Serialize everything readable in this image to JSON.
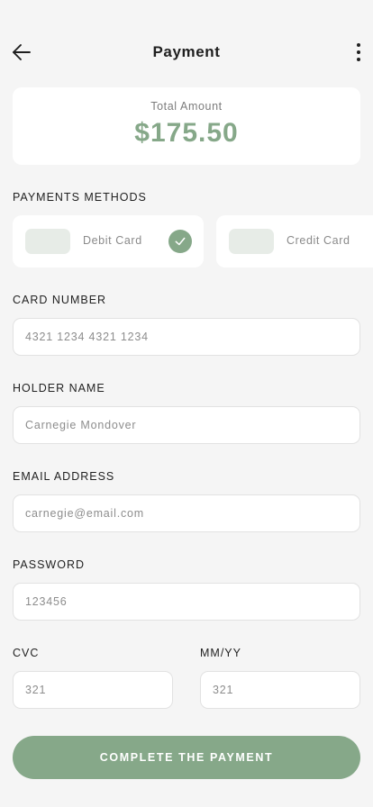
{
  "header": {
    "title": "Payment"
  },
  "total": {
    "label": "Total Amount",
    "amount": "$175.50"
  },
  "methods": {
    "section_label": "PAYMENTS METHODS",
    "items": [
      {
        "label": "Debit Card",
        "selected": true
      },
      {
        "label": "Credit Card",
        "selected": false
      }
    ]
  },
  "form": {
    "card_number": {
      "label": "CARD NUMBER",
      "placeholder": "4321 1234 4321 1234"
    },
    "holder_name": {
      "label": "HOLDER NAME",
      "placeholder": "Carnegie Mondover"
    },
    "email": {
      "label": "EMAIL ADDRESS",
      "placeholder": "carnegie@email.com"
    },
    "password": {
      "label": "PASSWORD",
      "placeholder": "123456"
    },
    "cvc": {
      "label": "CVC",
      "placeholder": "321"
    },
    "expiry": {
      "label": "MM/YY",
      "placeholder": "321"
    }
  },
  "actions": {
    "submit_label": "COMPLETE THE PAYMENT"
  },
  "colors": {
    "accent": "#86a889",
    "background": "#f5f5f5",
    "card": "#ffffff",
    "chip": "#e7ece7"
  },
  "icons": {
    "back": "arrow-left-icon",
    "more": "more-vertical-icon",
    "check": "check-icon"
  }
}
